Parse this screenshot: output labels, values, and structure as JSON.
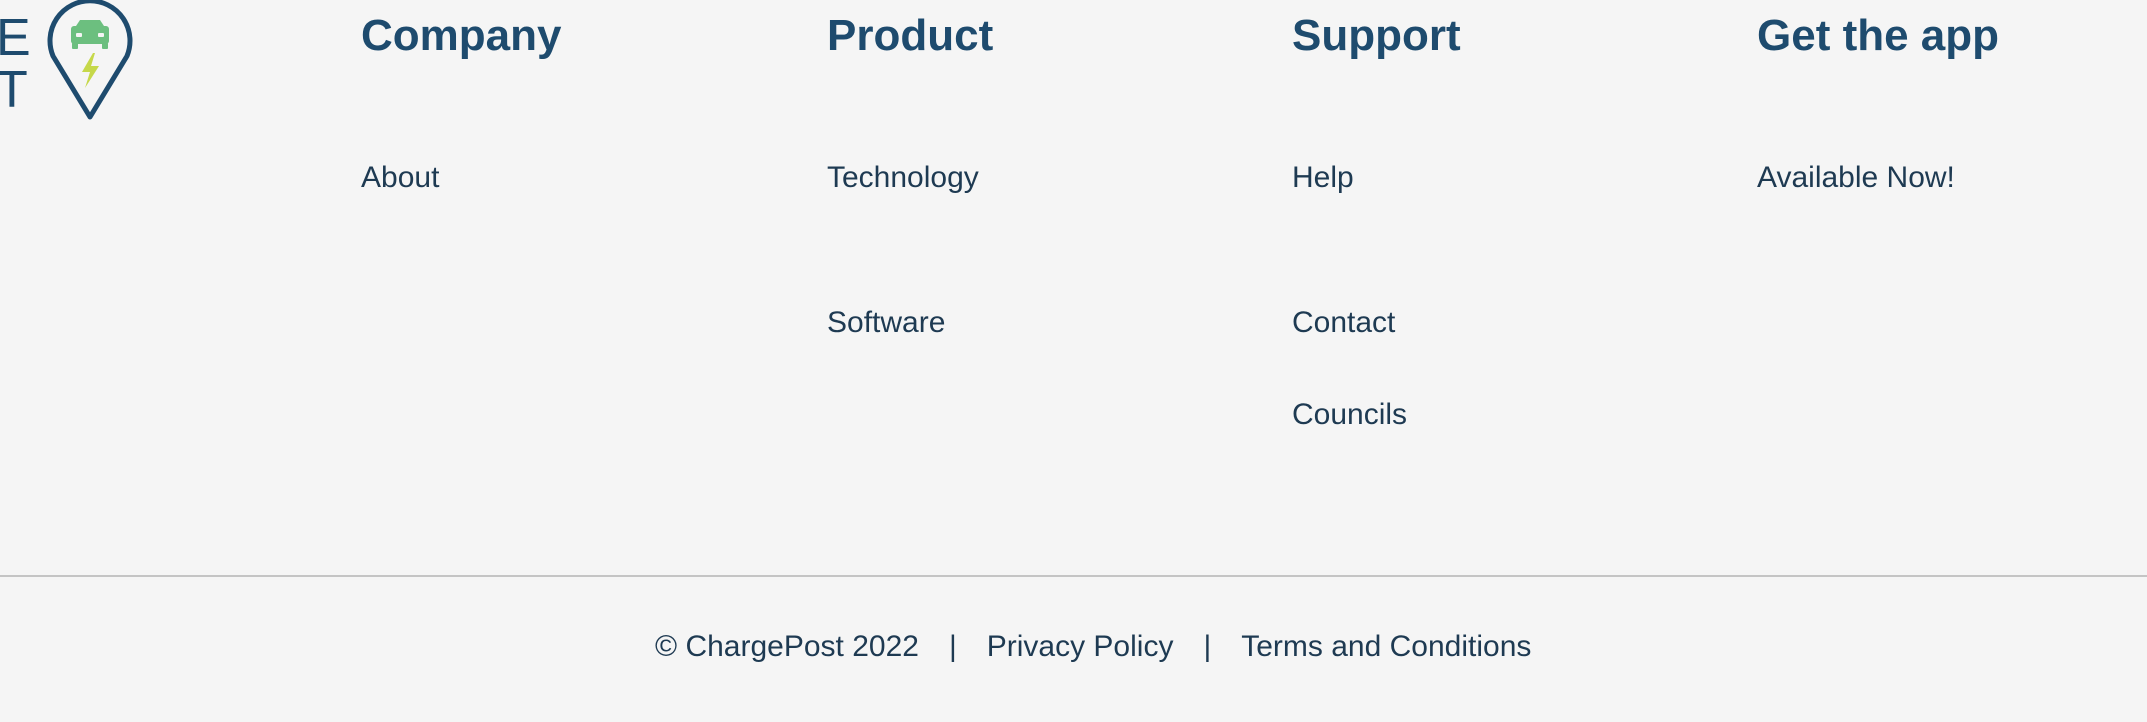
{
  "logo": {
    "letters": [
      "E",
      "T"
    ],
    "pin_icon": "map-pin-car-bolt-icon",
    "colors": {
      "pin_outline": "#1e4b6e",
      "car": "#6cbf7f",
      "bolt": "#c6d84a"
    }
  },
  "columns": {
    "company": {
      "heading": "Company",
      "links": [
        "About"
      ]
    },
    "product": {
      "heading": "Product",
      "links": [
        "Technology",
        "Software"
      ]
    },
    "support": {
      "heading": "Support",
      "links": [
        "Help",
        "Contact",
        "Councils"
      ]
    },
    "app": {
      "heading": "Get the app",
      "links": [
        "Available Now!"
      ]
    }
  },
  "bottom": {
    "copyright": "© ChargePost 2022",
    "separator": "|",
    "privacy": "Privacy Policy",
    "terms": "Terms and Conditions"
  },
  "colors": {
    "background": "#f5f5f5",
    "heading": "#1e4b6e",
    "text": "#1e3a52",
    "divider": "#c4c4c4"
  }
}
